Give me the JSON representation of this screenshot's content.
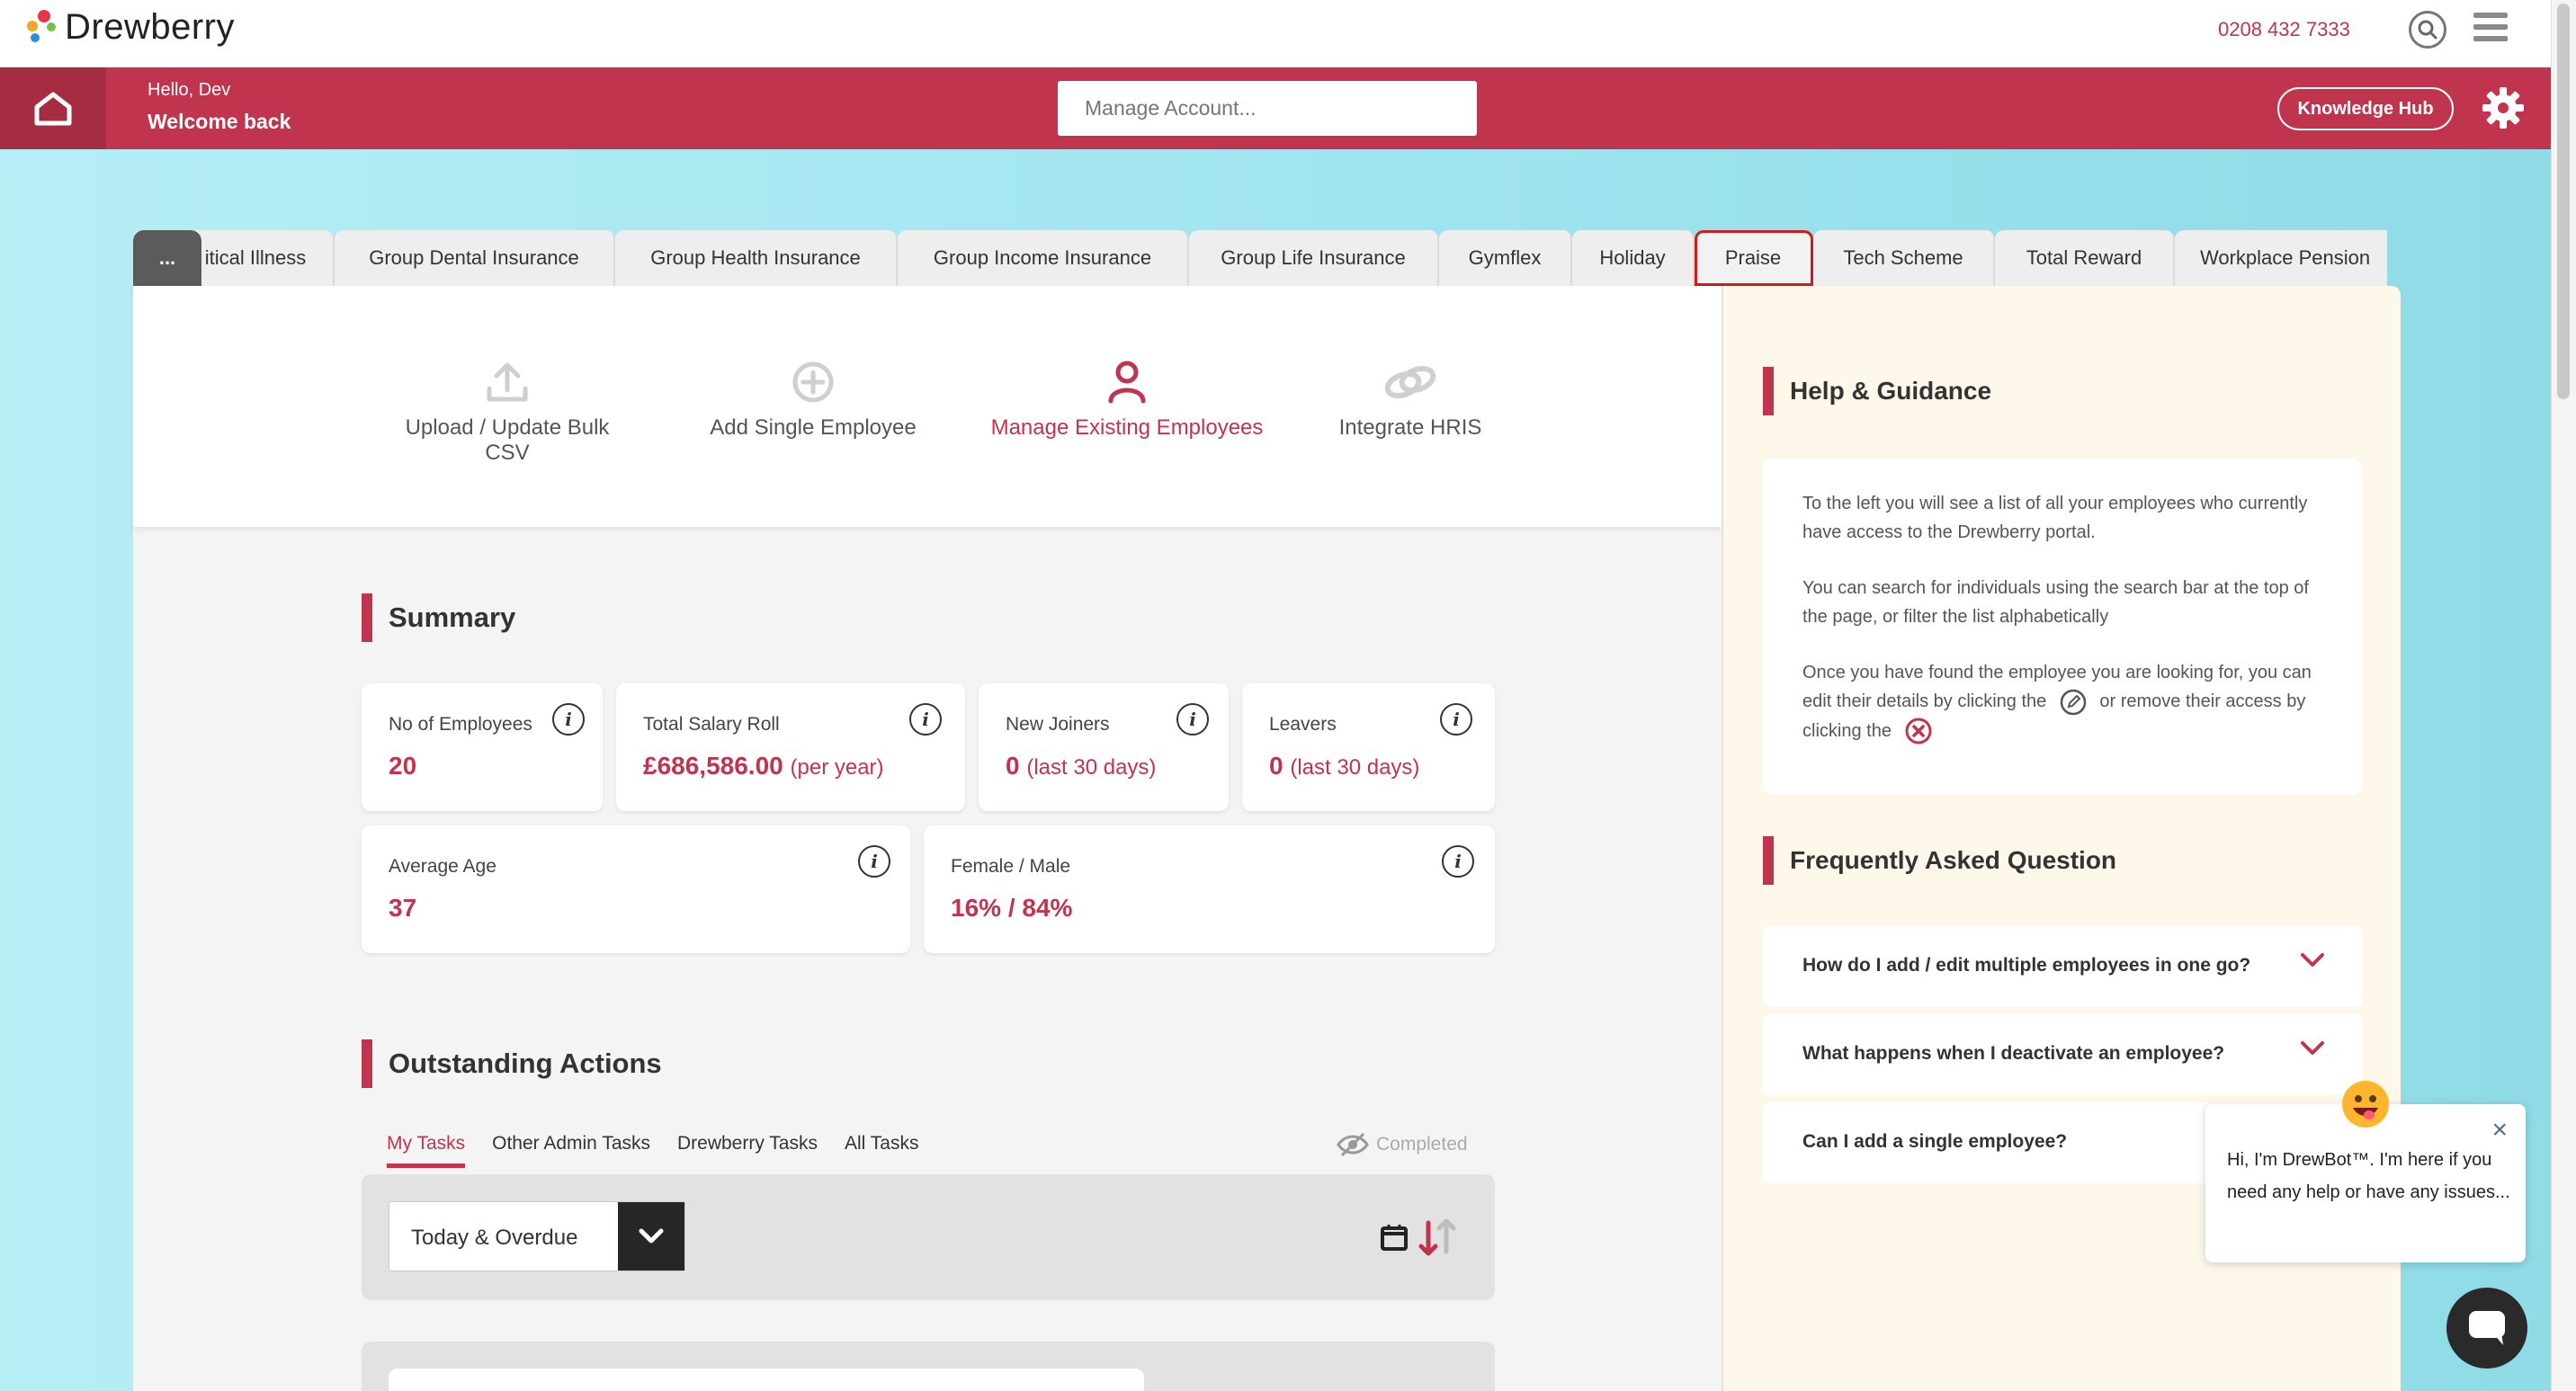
{
  "header": {
    "logo_text": "Drewberry",
    "phone": "0208 432 7333"
  },
  "redbar": {
    "hello": "Hello, Dev",
    "welcome": "Welcome back",
    "manage_placeholder": "Manage Account...",
    "knowledge_hub": "Knowledge Hub"
  },
  "tabs": {
    "more": "...",
    "items": [
      {
        "label": "itical Illness"
      },
      {
        "label": "Group Dental Insurance"
      },
      {
        "label": "Group Health Insurance"
      },
      {
        "label": "Group Income Insurance"
      },
      {
        "label": "Group Life Insurance"
      },
      {
        "label": "Gymflex"
      },
      {
        "label": "Holiday"
      },
      {
        "label": "Praise"
      },
      {
        "label": "Tech Scheme"
      },
      {
        "label": "Total Reward"
      },
      {
        "label": "Workplace Pension"
      }
    ]
  },
  "actions": {
    "upload": "Upload / Update Bulk CSV",
    "add": "Add Single Employee",
    "manage": "Manage Existing Employees",
    "integrate": "Integrate HRIS"
  },
  "summary": {
    "title": "Summary",
    "employees": {
      "label": "No of Employees",
      "value": "20"
    },
    "salary": {
      "label": "Total Salary Roll",
      "value": "£686,586.00",
      "sub": "(per year)"
    },
    "joiners": {
      "label": "New Joiners",
      "value": "0",
      "sub": "(last 30 days)"
    },
    "leavers": {
      "label": "Leavers",
      "value": "0",
      "sub": "(last 30 days)"
    },
    "age": {
      "label": "Average Age",
      "value": "37"
    },
    "gender": {
      "label": "Female / Male",
      "value": "16% / 84%"
    },
    "info_glyph": "i"
  },
  "outstanding": {
    "title": "Outstanding Actions",
    "tabs": [
      "My Tasks",
      "Other Admin Tasks",
      "Drewberry Tasks",
      "All Tasks"
    ],
    "completed": "Completed",
    "filter_value": "Today & Overdue"
  },
  "help": {
    "title": "Help & Guidance",
    "p1": "To the left you will see a list of all your employees who currently have access to the Drewberry portal.",
    "p2": "You can search for individuals using the search bar at the top of the page, or filter the list alphabetically",
    "p3a": "Once you have found the employee you are looking for, you can edit their details by clicking the",
    "p3b": "or remove their access by clicking the",
    "faq_title": "Frequently Asked Question",
    "faqs": [
      {
        "q": "How do I add / edit multiple employees in one go?"
      },
      {
        "q": "What happens when I deactivate an employee?"
      },
      {
        "q": "Can I add a single employee?"
      }
    ]
  },
  "chat": {
    "message": "Hi, I'm DrewBot™. I'm here if you need any help or have any issues...",
    "close": "×"
  },
  "colors": {
    "brand_red": "#c0344d",
    "dark": "#262626",
    "cyan_bg": "#a8e8f1",
    "help_bg": "#fdf8ea",
    "highlight_outline": "#d11a1a"
  }
}
